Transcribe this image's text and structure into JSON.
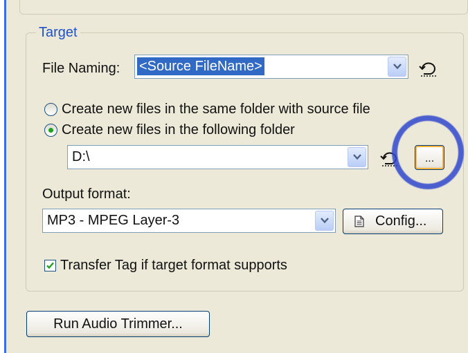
{
  "target": {
    "group_label": "Target",
    "file_naming": {
      "label": "File Naming:",
      "value": "<Source FileName>"
    },
    "location": {
      "option_same_folder": "Create new files in the same folder with source file",
      "option_following_folder": "Create new files in the following folder",
      "selected": "following_folder",
      "folder_value": "D:\\",
      "browse_label": "..."
    },
    "output_format": {
      "label": "Output format:",
      "value": "MP3 - MPEG Layer-3",
      "config_label": "Config..."
    },
    "transfer_tag": {
      "label": "Transfer Tag if target format supports",
      "checked": true
    }
  },
  "run_audio_trimmer_label": "Run Audio Trimmer...",
  "colors": {
    "accent": "#316ac5",
    "group_label": "#1f52c8",
    "highlight_ring": "#3046cd",
    "radio_dot": "#21a121",
    "check_mark": "#21a121"
  }
}
